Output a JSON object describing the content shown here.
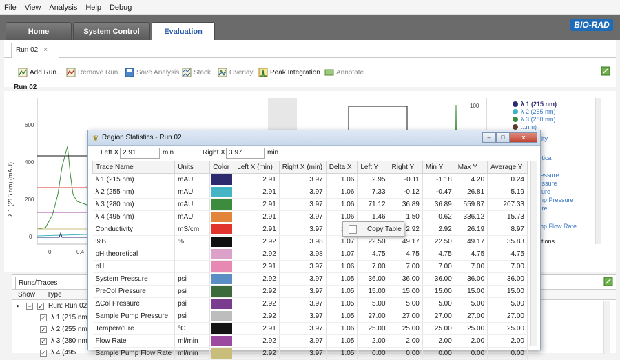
{
  "menu": [
    "File",
    "View",
    "Analysis",
    "Help",
    "Debug"
  ],
  "main_tabs": [
    {
      "label": "Home"
    },
    {
      "label": "System Control"
    },
    {
      "label": "Evaluation",
      "active": true
    }
  ],
  "brand": "BIO-RAD",
  "doc_tab": {
    "label": "Run 02",
    "close": "×"
  },
  "toolbar": {
    "add_run": "Add Run...",
    "remove_run": "Remove Run...",
    "save_analysis": "Save Analysis",
    "stack": "Stack",
    "overlay": "Overlay",
    "peak_integration": "Peak Integration",
    "annotate": "Annotate"
  },
  "run_title": "Run 02",
  "chart": {
    "y_label": "λ 1 (215 nm) (mAU)",
    "y_ticks": [
      "600",
      "400",
      "200",
      "0"
    ],
    "x_ticks": [
      "0",
      "0.4"
    ],
    "right_tick": "100"
  },
  "legend": [
    {
      "label": "λ 1 (215 nm)",
      "color": "#2e2a6e",
      "active": true
    },
    {
      "label": "λ 2 (255 nm)",
      "color": "#3fb3c2"
    },
    {
      "label": "λ 3 (280 nm)",
      "color": "#3b8b3e"
    },
    {
      "label": "...nm)",
      "color": "#5a3d2a"
    },
    {
      "label": "...vity"
    },
    {
      "label": "...etical"
    },
    {
      "label": "...ressure"
    },
    {
      "label": "...essure"
    },
    {
      "label": "...sure"
    },
    {
      "label": "...mp Pressure"
    },
    {
      "label": "...ure"
    },
    {
      "label": "...mp Flow Rate"
    },
    {
      "label": "...ctions"
    }
  ],
  "lower": {
    "tab": "Runs/Traces",
    "headers": [
      "Show",
      "Type"
    ],
    "rows": [
      {
        "label": "Run: Run 02",
        "checked": true,
        "expand": "▸"
      },
      {
        "label": "λ 1 (215 nm)",
        "checked": true
      },
      {
        "label": "λ 2 (255 nm)",
        "checked": true
      },
      {
        "label": "λ 3 (280 nm)",
        "checked": true
      },
      {
        "label": "λ 4 (495",
        "checked": true
      }
    ]
  },
  "dialog": {
    "title": "Region Statistics - Run 02",
    "left_x_label": "Left X",
    "left_x_value": "2.91",
    "right_x_label": "Right X",
    "right_x_value": "3.97",
    "unit": "min",
    "columns": [
      "Trace Name",
      "Units",
      "Color",
      "Left X (min)",
      "Right X (min)",
      "Delta X",
      "Left Y",
      "Right Y",
      "Min Y",
      "Max Y",
      "Average Y"
    ],
    "rows": [
      {
        "name": "λ 1 (215 nm)",
        "units": "mAU",
        "color": "#2e2a6e",
        "lx": "2.91",
        "rx": "3.97",
        "dx": "1.06",
        "ly": "2.95",
        "ry": "-0.11",
        "miny": "-1.18",
        "maxy": "4.20",
        "avg": "0.24"
      },
      {
        "name": "λ 2 (255 nm)",
        "units": "mAU",
        "color": "#43b5c4",
        "lx": "2.91",
        "rx": "3.97",
        "dx": "1.06",
        "ly": "7.33",
        "ry": "-0.12",
        "miny": "-0.47",
        "maxy": "26.81",
        "avg": "5.19"
      },
      {
        "name": "λ 3 (280 nm)",
        "units": "mAU",
        "color": "#3d8b3d",
        "lx": "2.91",
        "rx": "3.97",
        "dx": "1.06",
        "ly": "71.12",
        "ry": "36.89",
        "miny": "36.89",
        "maxy": "559.87",
        "avg": "207.33"
      },
      {
        "name": "λ 4 (495 nm)",
        "units": "mAU",
        "color": "#e2853a",
        "lx": "2.91",
        "rx": "3.97",
        "dx": "1.06",
        "ly": "1.46",
        "ry": "1.50",
        "miny": "0.62",
        "maxy": "336.12",
        "avg": "15.73"
      },
      {
        "name": "Conductivity",
        "units": "mS/cm",
        "color": "#e1342c",
        "lx": "2.91",
        "rx": "3.97",
        "dx": "1.06",
        "ly": "",
        "ry": "2.92",
        "miny": "2.92",
        "maxy": "26.19",
        "avg": "8.97"
      },
      {
        "name": "%B",
        "units": "%",
        "color": "#111111",
        "lx": "2.92",
        "rx": "3.98",
        "dx": "1.07",
        "ly": "22.50",
        "ry": "49.17",
        "miny": "22.50",
        "maxy": "49.17",
        "avg": "35.83"
      },
      {
        "name": "pH theoretical",
        "units": "",
        "color": "#dca1c9",
        "lx": "2.92",
        "rx": "3.98",
        "dx": "1.07",
        "ly": "4.75",
        "ry": "4.75",
        "miny": "4.75",
        "maxy": "4.75",
        "avg": "4.75"
      },
      {
        "name": "pH",
        "units": "",
        "color": "#e889b4",
        "lx": "2.91",
        "rx": "3.97",
        "dx": "1.06",
        "ly": "7.00",
        "ry": "7.00",
        "miny": "7.00",
        "maxy": "7.00",
        "avg": "7.00"
      },
      {
        "name": "System Pressure",
        "units": "psi",
        "color": "#5a8ec4",
        "lx": "2.92",
        "rx": "3.97",
        "dx": "1.05",
        "ly": "36.00",
        "ry": "36.00",
        "miny": "36.00",
        "maxy": "36.00",
        "avg": "36.00"
      },
      {
        "name": "PreCol Pressure",
        "units": "psi",
        "color": "#3b6a3b",
        "lx": "2.92",
        "rx": "3.97",
        "dx": "1.05",
        "ly": "15.00",
        "ry": "15.00",
        "miny": "15.00",
        "maxy": "15.00",
        "avg": "15.00"
      },
      {
        "name": "ΔCol Pressure",
        "units": "psi",
        "color": "#7a3c8f",
        "lx": "2.92",
        "rx": "3.97",
        "dx": "1.05",
        "ly": "5.00",
        "ry": "5.00",
        "miny": "5.00",
        "maxy": "5.00",
        "avg": "5.00"
      },
      {
        "name": "Sample Pump Pressure",
        "units": "psi",
        "color": "#bdbdbd",
        "lx": "2.92",
        "rx": "3.97",
        "dx": "1.05",
        "ly": "27.00",
        "ry": "27.00",
        "miny": "27.00",
        "maxy": "27.00",
        "avg": "27.00"
      },
      {
        "name": "Temperature",
        "units": "°C",
        "color": "#141414",
        "lx": "2.91",
        "rx": "3.97",
        "dx": "1.06",
        "ly": "25.00",
        "ry": "25.00",
        "miny": "25.00",
        "maxy": "25.00",
        "avg": "25.00"
      },
      {
        "name": "Flow Rate",
        "units": "ml/min",
        "color": "#9c4aa0",
        "lx": "2.92",
        "rx": "3.97",
        "dx": "1.05",
        "ly": "2.00",
        "ry": "2.00",
        "miny": "2.00",
        "maxy": "2.00",
        "avg": "2.00"
      },
      {
        "name": "Sample Pump Flow Rate",
        "units": "ml/min",
        "color": "#c8bd7a",
        "lx": "2.92",
        "rx": "3.97",
        "dx": "1.05",
        "ly": "0.00",
        "ry": "0.00",
        "miny": "0.00",
        "maxy": "0.00",
        "avg": "0.00"
      }
    ]
  },
  "context_menu": {
    "copy_table": "Copy Table"
  }
}
